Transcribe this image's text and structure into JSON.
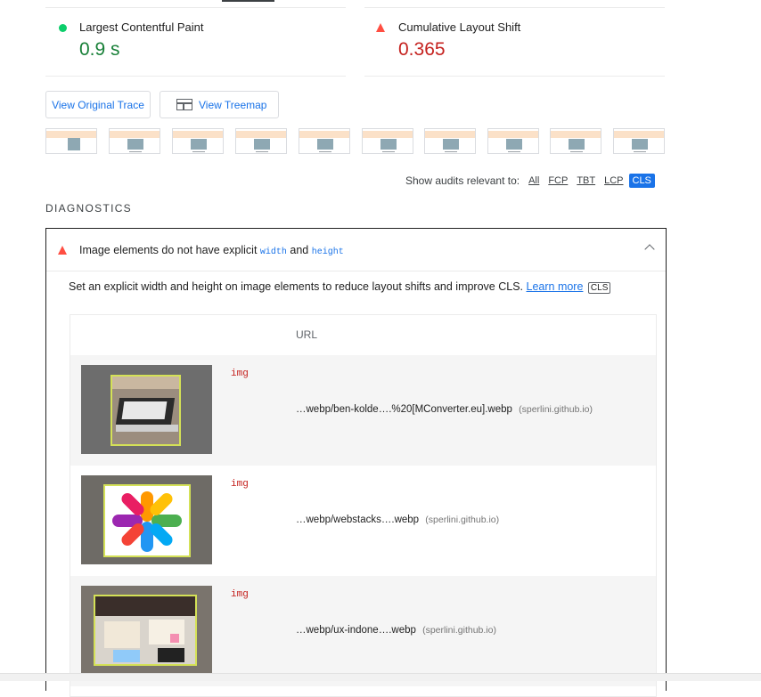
{
  "metrics": [
    {
      "label": "Largest Contentful Paint",
      "value": "0.9 s",
      "status": "pass",
      "color": "#0cce6b",
      "value_color": "#188038"
    },
    {
      "label": "Cumulative Layout Shift",
      "value": "0.365",
      "status": "fail",
      "color": "#ff4e42",
      "value_color": "#c5221f"
    }
  ],
  "buttons": {
    "view_trace": "View Original Trace",
    "view_treemap": "View Treemap"
  },
  "filmstrip": {
    "frames": 10
  },
  "audit_filter": {
    "label": "Show audits relevant to:",
    "options": [
      "All",
      "FCP",
      "TBT",
      "LCP",
      "CLS"
    ],
    "active": "CLS"
  },
  "diagnostics": {
    "title": "DIAGNOSTICS",
    "audit": {
      "title_prefix": "Image elements do not have explicit",
      "code1": "width",
      "and": "and",
      "code2": "height",
      "description": "Set an explicit width and height on image elements to reduce layout shifts and improve CLS.",
      "learn_more": "Learn more",
      "tag": "CLS",
      "table": {
        "header": "URL",
        "rows": [
          {
            "element": "img",
            "url": "…webp/ben-kolde….%20[MConverter.eu].webp",
            "origin": "(sperlini.github.io)"
          },
          {
            "element": "img",
            "url": "…webp/webstacks….webp",
            "origin": "(sperlini.github.io)"
          },
          {
            "element": "img",
            "url": "…webp/ux-indone….webp",
            "origin": "(sperlini.github.io)"
          }
        ]
      }
    }
  }
}
